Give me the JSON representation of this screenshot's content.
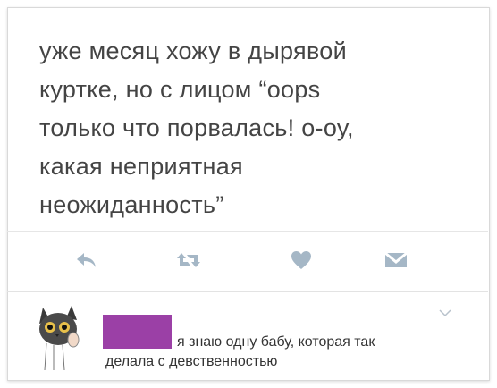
{
  "tweet": {
    "lines": [
      "уже месяц хожу в дырявой",
      "куртке, но с лицом “oops",
      "только что порвалась! о-оу,",
      "какая неприятная",
      "неожиданность”"
    ]
  },
  "actions": {
    "reply_icon": "reply-icon",
    "retweet_icon": "retweet-icon",
    "like_icon": "heart-icon",
    "dm_icon": "direct-message-icon",
    "icon_color": "#a5b7c6"
  },
  "reply": {
    "line1": "я знаю одну бабу, которая так",
    "line2": "делала с девственностью",
    "redaction_color": "#9b40a6"
  }
}
